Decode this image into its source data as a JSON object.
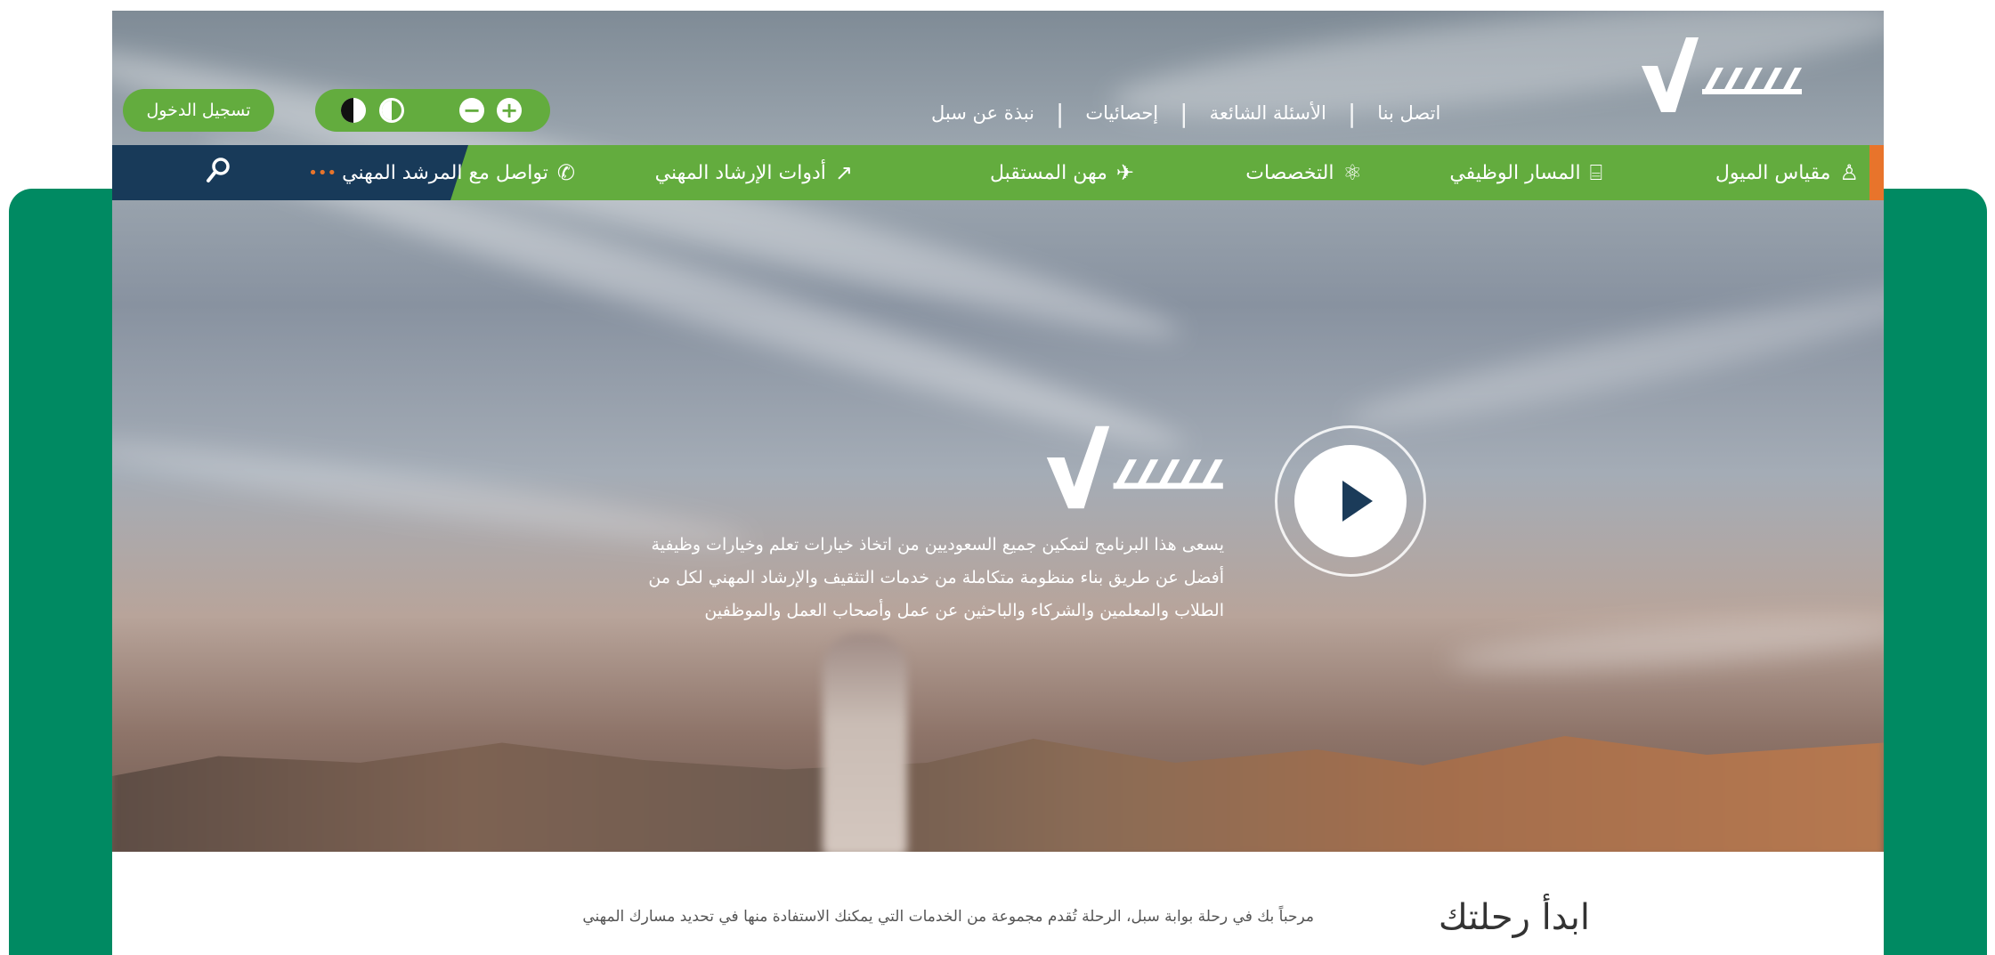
{
  "brand": {
    "logo_text": "سبل",
    "colors": {
      "green": "#63ac3e",
      "navy": "#183a59",
      "orange": "#e8742b",
      "frame": "#008a62"
    }
  },
  "header": {
    "top_links": [
      "نبذة عن سبل",
      "إحصائيات",
      "الأسئلة الشائعة",
      "اتصل بنا"
    ],
    "login_label": "تسجيل الدخول",
    "accessibility": {
      "increase": "+",
      "decrease": "−"
    }
  },
  "nav": {
    "items": [
      {
        "label": "مقياس الميول",
        "icon": "person-icon",
        "glyph": "♙"
      },
      {
        "label": "المسار الوظيفي",
        "icon": "briefcase-icon",
        "glyph": "⌸"
      },
      {
        "label": "التخصصات",
        "icon": "atom-icon",
        "glyph": "⚛"
      },
      {
        "label": "مهن المستقبل",
        "icon": "rocket-icon",
        "glyph": "✈"
      },
      {
        "label": "أدوات الإرشاد المهني",
        "icon": "chart-line-icon",
        "glyph": "↗"
      },
      {
        "label": "تواصل مع المرشد المهني",
        "icon": "chat-icon",
        "glyph": "✆"
      }
    ]
  },
  "hero": {
    "description": [
      "يسعى هذا البرنامج لتمكين جميع السعوديين من اتخاذ خيارات تعلم وخيارات وظيفية",
      "أفضل عن طريق بناء منظومة متكاملة من خدمات التثقيف والإرشاد المهني لكل من",
      "الطلاب والمعلمين والشركاء والباحثين عن عمل وأصحاب العمل والموظفين"
    ]
  },
  "journey": {
    "title": "ابدأ رحلتك",
    "text": "مرحباً بك في رحلة بوابة سبل، الرحلة تُقدم مجموعة من الخدمات التي يمكنك الاستفادة منها في تحديد مسارك المهني"
  }
}
